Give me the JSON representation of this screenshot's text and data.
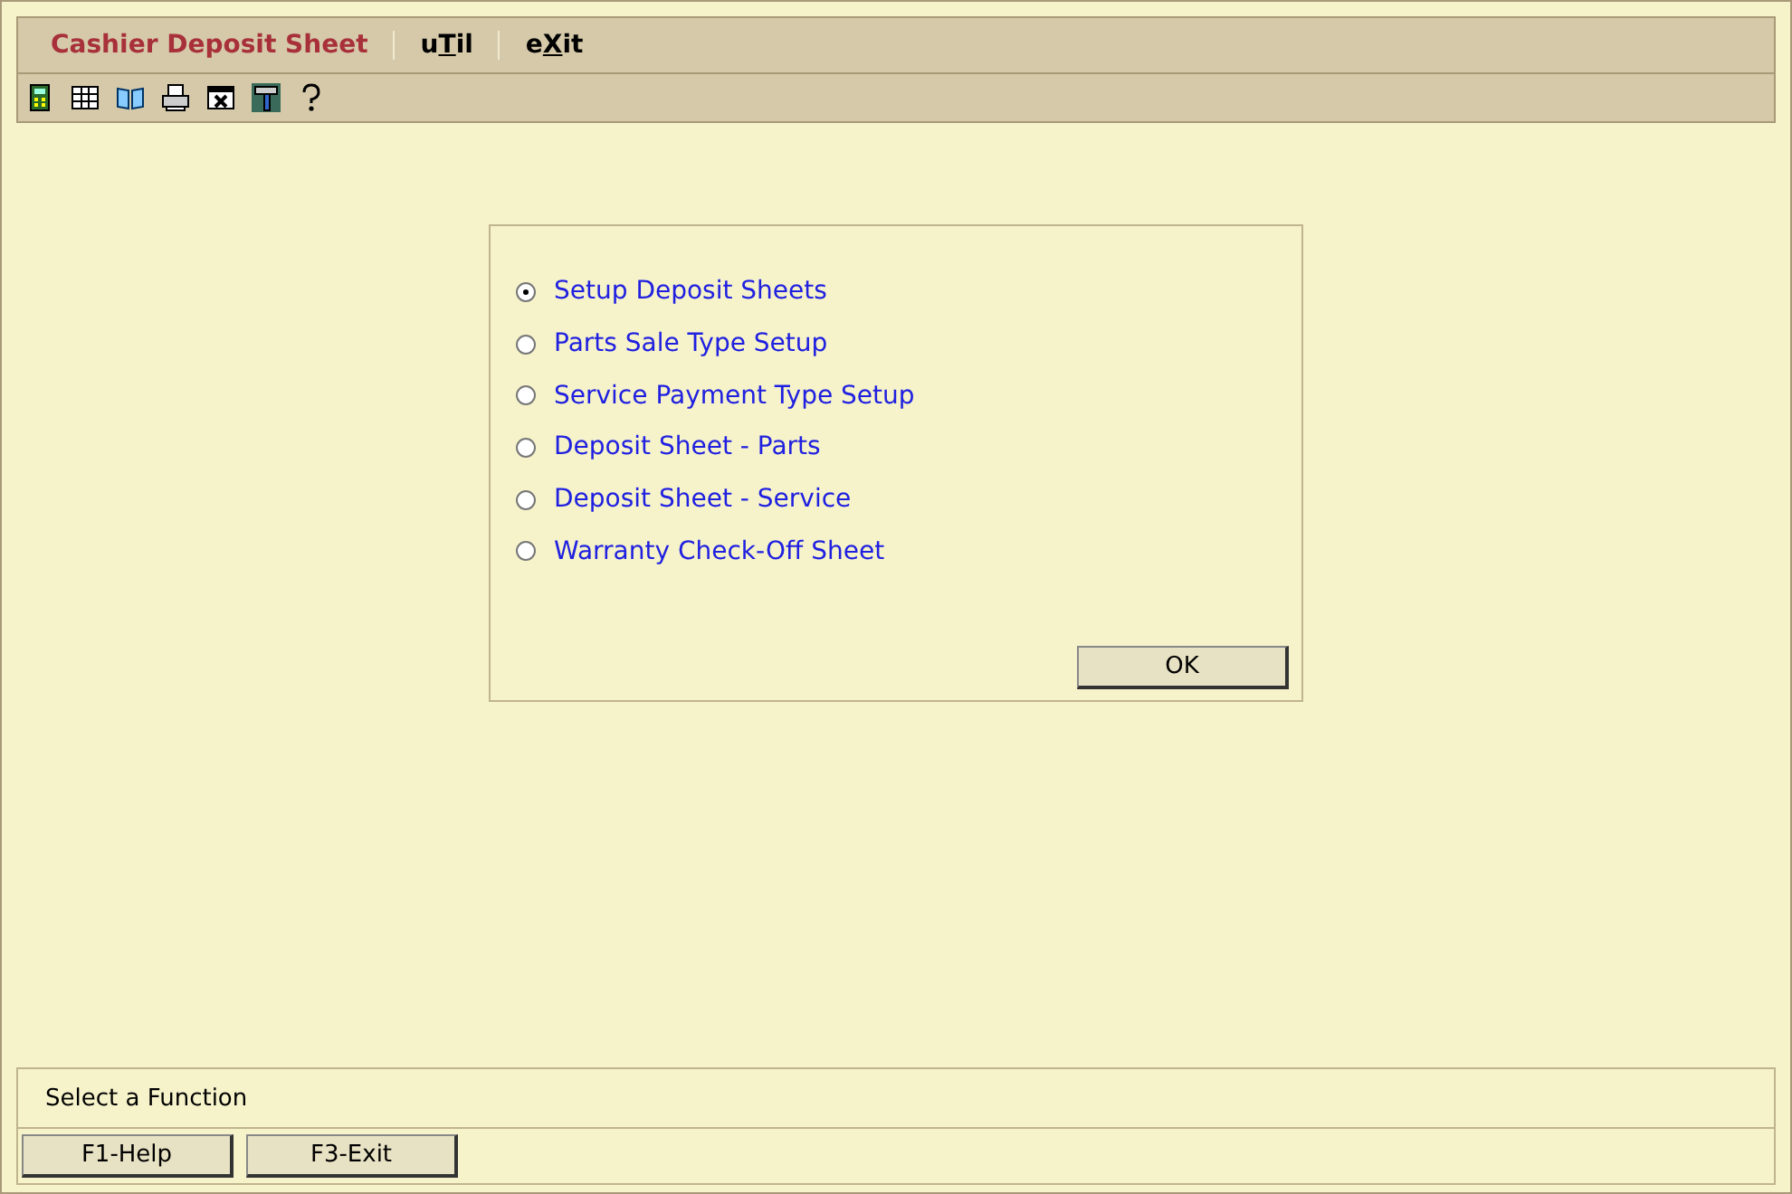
{
  "menu_bar": {
    "title": "Cashier Deposit Sheet",
    "menus": [
      {
        "before": "u",
        "access_key": "T",
        "after": "il"
      },
      {
        "before": "e",
        "access_key": "X",
        "after": "it"
      }
    ]
  },
  "dialog": {
    "options": [
      {
        "label": "Setup Deposit Sheets",
        "selected": true
      },
      {
        "label": "Parts Sale Type Setup",
        "selected": false
      },
      {
        "label": "Service Payment Type Setup",
        "selected": false
      },
      {
        "label": "Deposit Sheet - Parts",
        "selected": false
      },
      {
        "label": "Deposit Sheet - Service",
        "selected": false
      },
      {
        "label": "Warranty Check-Off Sheet",
        "selected": false
      }
    ],
    "ok_button": "OK"
  },
  "status_bar": {
    "message": "Select a Function"
  },
  "function_keys": [
    "F1-Help",
    "F3-Exit"
  ]
}
